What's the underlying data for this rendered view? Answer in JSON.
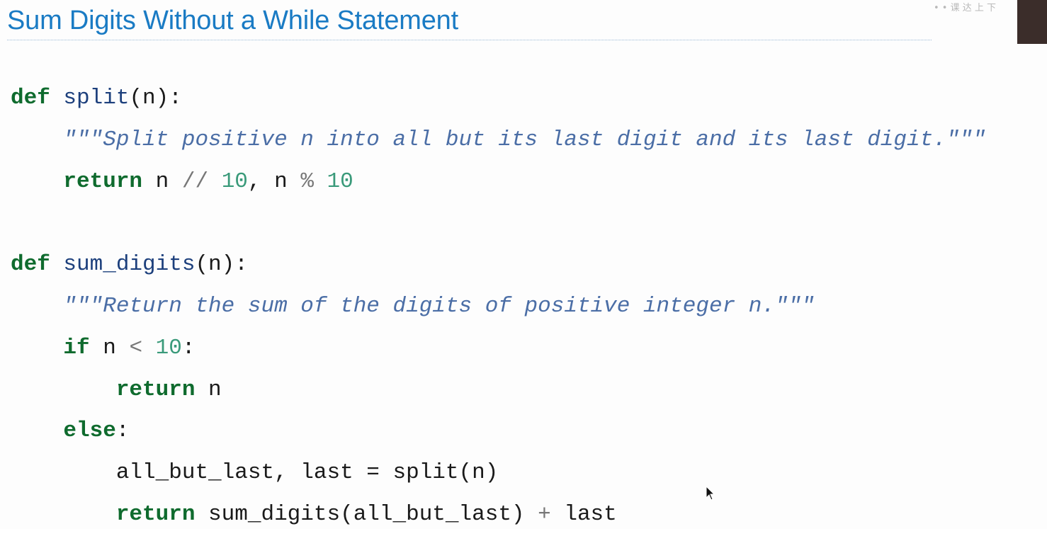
{
  "slide": {
    "title": "Sum Digits Without a While Statement",
    "watermark": "• • 课 达 上 下",
    "colors": {
      "title": "#1a7bc4",
      "keyword": "#0f6b2e",
      "function_name": "#1c3f7c",
      "docstring": "#4b6ea6",
      "number": "#3a9a7a"
    }
  },
  "code": {
    "l1": {
      "kw": "def",
      "fn": "split",
      "rest": "(n):"
    },
    "l2": {
      "indent": "    ",
      "doc": "\"\"\"Split positive n into all but its last digit and its last digit.\"\"\""
    },
    "l3": {
      "indent": "    ",
      "kw": "return",
      "a": " n ",
      "op1": "//",
      "b": " ",
      "num1": "10",
      "c": ", n ",
      "op2": "%",
      "d": " ",
      "num2": "10"
    },
    "l5": {
      "kw": "def",
      "fn": "sum_digits",
      "rest": "(n):"
    },
    "l6": {
      "indent": "    ",
      "doc": "\"\"\"Return the sum of the digits of positive integer n.\"\"\""
    },
    "l7": {
      "indent": "    ",
      "kw": "if",
      "a": " n ",
      "op": "<",
      "b": " ",
      "num": "10",
      "c": ":"
    },
    "l8": {
      "indent": "        ",
      "kw": "return",
      "a": " n"
    },
    "l9": {
      "indent": "    ",
      "kw": "else",
      "a": ":"
    },
    "l10": {
      "indent": "        ",
      "text": "all_but_last, last = split(n)"
    },
    "l11": {
      "indent": "        ",
      "kw": "return",
      "a": " sum_digits(all_but_last) ",
      "op": "+",
      "b": " last"
    }
  },
  "icons": {
    "cursor": "mouse-pointer-icon"
  }
}
